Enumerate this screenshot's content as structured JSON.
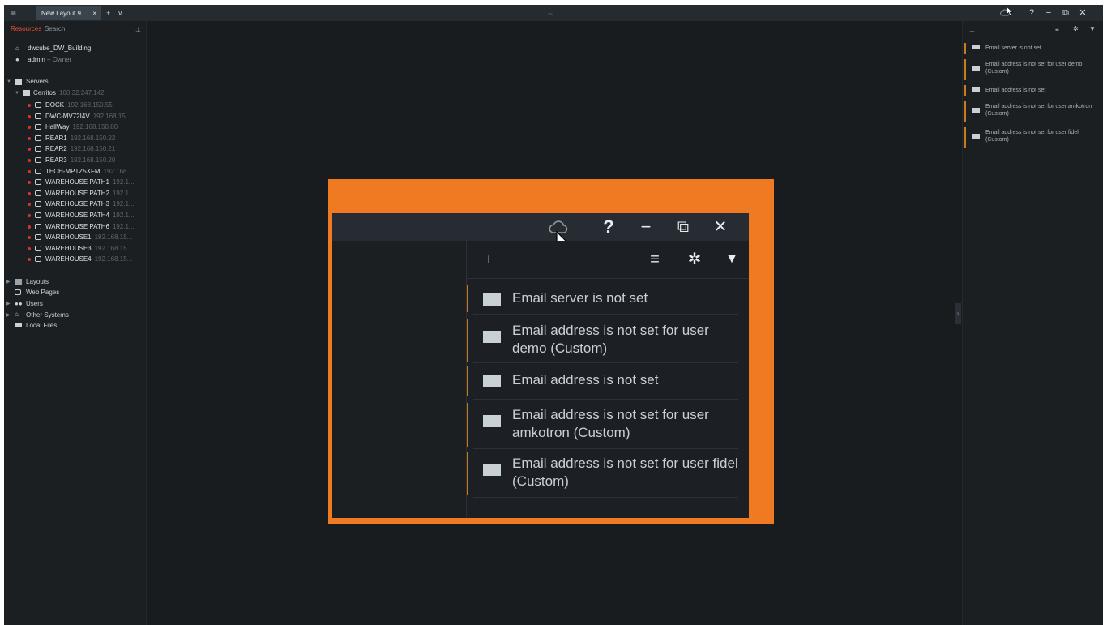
{
  "titlebar": {
    "menu_icon": "hamburger-icon",
    "tab_label": "New Layout 9",
    "tab_close": "×",
    "new_tab": "+",
    "tab_menu": "∨",
    "win_help": "?",
    "win_min": "−",
    "win_restore": "⧉",
    "win_close": "✕"
  },
  "left_panel": {
    "tab_resources": "Resources",
    "tab_search": "Search",
    "system_name": "dwcube_DW_Building",
    "user_name": "admin",
    "user_role": "– Owner",
    "servers_label": "Servers",
    "server": {
      "name": "Cerritos",
      "ip": "100.32.247.142"
    },
    "cameras": [
      {
        "name": "DOCK",
        "ip": "192.168.150.55"
      },
      {
        "name": "DWC-MV72I4V",
        "ip": "192.168.15..."
      },
      {
        "name": "HallWay",
        "ip": "192.168.150.80"
      },
      {
        "name": "REAR1",
        "ip": "192.168.150.22"
      },
      {
        "name": "REAR2",
        "ip": "192.168.150.21"
      },
      {
        "name": "REAR3",
        "ip": "192.168.150.20"
      },
      {
        "name": "TECH-MPTZ5XFM",
        "ip": "192.168..."
      },
      {
        "name": "WAREHOUSE PATH1",
        "ip": "192.1..."
      },
      {
        "name": "WAREHOUSE PATH2",
        "ip": "192.1..."
      },
      {
        "name": "WAREHOUSE PATH3",
        "ip": "192.1..."
      },
      {
        "name": "WAREHOUSE PATH4",
        "ip": "192.1..."
      },
      {
        "name": "WAREHOUSE PATH6",
        "ip": "192.1..."
      },
      {
        "name": "WAREHOUSE1",
        "ip": "192.168.15..."
      },
      {
        "name": "WAREHOUSE3",
        "ip": "192.168.15..."
      },
      {
        "name": "WAREHOUSE4",
        "ip": "192.168.15..."
      }
    ],
    "layouts_label": "Layouts",
    "web_pages_label": "Web Pages",
    "users_label": "Users",
    "other_systems_label": "Other Systems",
    "local_files_label": "Local Files"
  },
  "notifications": [
    {
      "text": "Email server is not set"
    },
    {
      "text": "Email address is not set for user demo (Custom)"
    },
    {
      "text": "Email address is not set"
    },
    {
      "text": "Email address is not set for user amkotron (Custom)"
    },
    {
      "text": "Email address is not set for user fidel (Custom)"
    }
  ],
  "notif_toolbar": {
    "pin_icon": "pin-icon",
    "list_icon": "list-icon",
    "settings_icon": "gear-icon",
    "filter_icon": "filter-icon"
  },
  "colors": {
    "highlight_border": "#ef7a21",
    "notification_accent": "#c57c1b",
    "camera_status": "#d8332b",
    "active_tab_text": "#e8512b"
  }
}
